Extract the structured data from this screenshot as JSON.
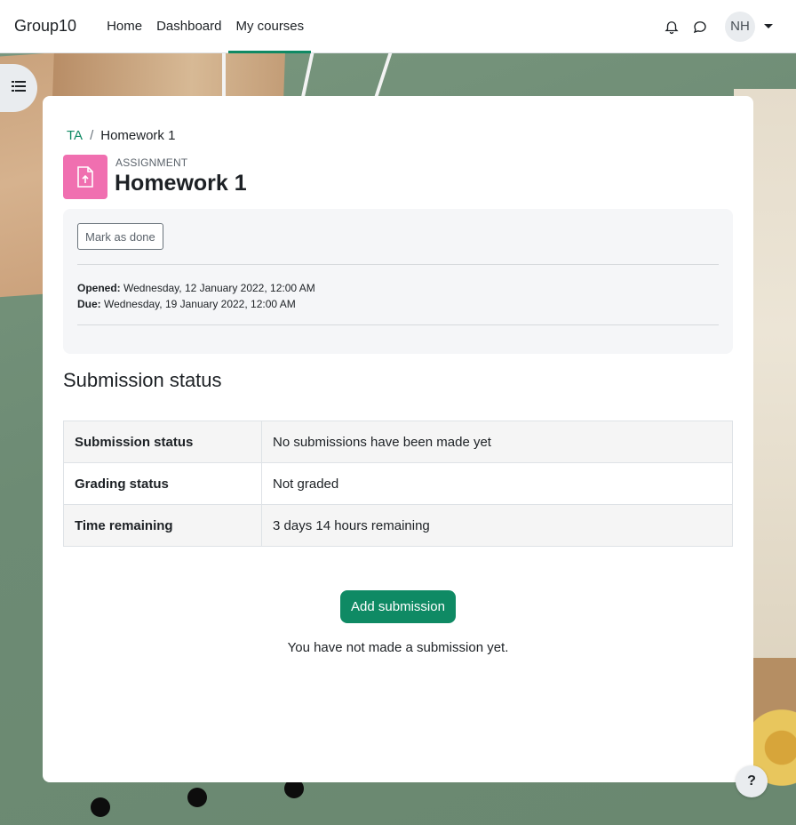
{
  "navbar": {
    "brand": "Group10",
    "links": [
      {
        "label": "Home"
      },
      {
        "label": "Dashboard"
      },
      {
        "label": "My courses"
      }
    ],
    "active_link": "My courses",
    "icons": [
      "bell-icon",
      "chat-icon"
    ],
    "user_initials": "NH"
  },
  "drawer": {
    "icon": "list-icon"
  },
  "breadcrumb": {
    "items": [
      "TA",
      "Homework 1"
    ],
    "separator": "/"
  },
  "activity": {
    "type_label": "ASSIGNMENT",
    "title": "Homework 1",
    "icon": "file-upload-icon",
    "icon_color": "#f06fb0"
  },
  "activity_info": {
    "mark_done_label": "Mark as done",
    "opened_label": "Opened:",
    "opened_value": "Wednesday, 12 January 2022, 12:00 AM",
    "due_label": "Due:",
    "due_value": "Wednesday, 19 January 2022, 12:00 AM"
  },
  "submission": {
    "section_title": "Submission status",
    "rows": [
      {
        "label": "Submission status",
        "value": "No submissions have been made yet"
      },
      {
        "label": "Grading status",
        "value": "Not graded"
      },
      {
        "label": "Time remaining",
        "value": "3 days 14 hours remaining"
      }
    ],
    "add_button_label": "Add submission",
    "no_submission_text": "You have not made a submission yet."
  },
  "help": {
    "label": "?"
  },
  "colors": {
    "accent": "#0f8a64",
    "activity_icon_bg": "#f06fb0"
  }
}
